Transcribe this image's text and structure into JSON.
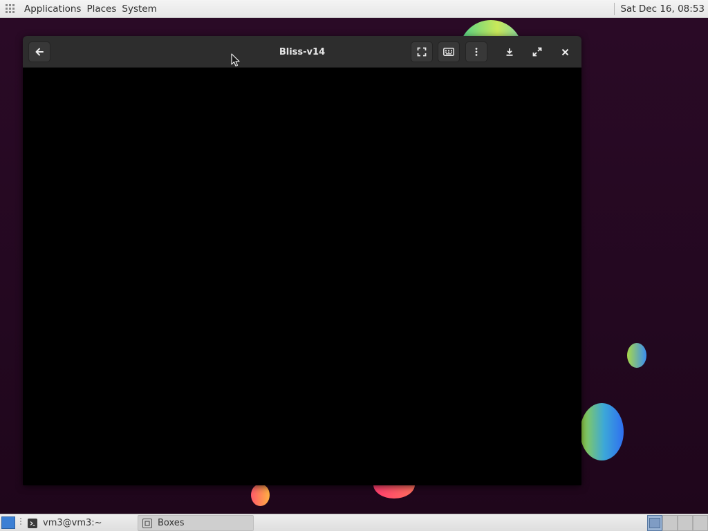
{
  "top_panel": {
    "menus": [
      "Applications",
      "Places",
      "System"
    ],
    "clock": "Sat Dec 16, 08:53"
  },
  "window": {
    "title": "Bliss-v14",
    "toolbar": {
      "back": "arrow-left-icon",
      "fullscreen": "fullscreen-icon",
      "keyboard": "keyboard-icon",
      "menu": "kebab-menu-icon",
      "download": "download-icon",
      "maximize": "maximize-icon",
      "close": "close-icon"
    }
  },
  "taskbar": {
    "tasks": [
      {
        "label": "vm3@vm3:~",
        "icon": "terminal-icon",
        "active": false
      },
      {
        "label": "Boxes",
        "icon": "boxes-app-icon",
        "active": true
      }
    ],
    "workspaces": 4,
    "active_workspace": 1
  },
  "colors": {
    "desktop_background": "#24091f",
    "headerbar": "#2d2d2d",
    "vm_display": "#000000",
    "panel": "#e6e6e6",
    "workspace_active": "#9bb4d4"
  }
}
